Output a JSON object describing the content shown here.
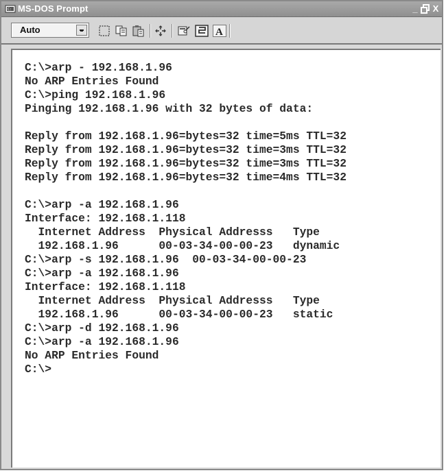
{
  "window": {
    "title": "MS-DOS Prompt",
    "buttons": {
      "minimize": "_",
      "restore": "❐",
      "close": "X"
    }
  },
  "toolbar": {
    "font_select_value": "Auto",
    "icons": [
      "mark-icon",
      "copy-icon",
      "paste-icon",
      "full-screen-icon",
      "properties-icon",
      "background-icon",
      "font-icon"
    ]
  },
  "console": {
    "lines": [
      "C:\\>arp - 192.168.1.96",
      "No ARP Entries Found",
      "C:\\>ping 192.168.1.96",
      "Pinging 192.168.1.96 with 32 bytes of data:",
      "",
      "Reply from 192.168.1.96=bytes=32 time=5ms TTL=32",
      "Reply from 192.168.1.96=bytes=32 time=3ms TTL=32",
      "Reply from 192.168.1.96=bytes=32 time=3ms TTL=32",
      "Reply from 192.168.1.96=bytes=32 time=4ms TTL=32",
      "",
      "C:\\>arp -a 192.168.1.96",
      "Interface: 192.168.1.118",
      "  Internet Address  Physical Addresss   Type",
      "  192.168.1.96      00-03-34-00-00-23   dynamic",
      "C:\\>arp -s 192.168.1.96  00-03-34-00-00-23",
      "C:\\>arp -a 192.168.1.96",
      "Interface: 192.168.1.118",
      "  Internet Address  Physical Addresss   Type",
      "  192.168.1.96      00-03-34-00-00-23   static",
      "C:\\>arp -d 192.168.1.96",
      "C:\\>arp -a 192.168.1.96",
      "No ARP Entries Found",
      "C:\\>"
    ]
  },
  "colors": {
    "titlebar": "#9c9c9c",
    "toolbar": "#d6d6d6",
    "console_bg": "#ffffff",
    "console_text": "#2a2a2a"
  }
}
